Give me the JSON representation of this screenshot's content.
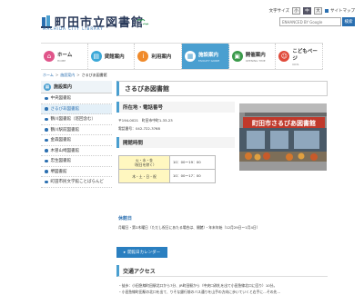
{
  "header": {
    "logo_title": "町田市立図書館",
    "logo_subtitle": "MACHIDA CITY LIBRARY",
    "font_size_label": "文字サイズ",
    "font_sizes": [
      "小",
      "中",
      "大"
    ],
    "sitemap_label": "サイトマップ",
    "search_placeholder": "ENHANCED BY Google",
    "search_button": "検索"
  },
  "nav": [
    {
      "jp": "ホーム",
      "en": "HOME",
      "icon": "home-icon",
      "color": "#e0558a"
    },
    {
      "jp": "貸館案内",
      "en": "",
      "icon": "book-icon",
      "color": "#3aa8d8"
    },
    {
      "jp": "利用案内",
      "en": "",
      "icon": "info-icon",
      "color": "#f08a2a"
    },
    {
      "jp": "施設案内",
      "en": "FACILITY GUIDE",
      "icon": "facility-icon",
      "color": "#ffffff"
    },
    {
      "jp": "開催案内",
      "en": "OPENING TIME",
      "icon": "calendar-icon",
      "color": "#3a9a4a"
    },
    {
      "jp": "こどもページ",
      "en": "KIDS",
      "icon": "kids-icon",
      "color": "#e04a3a"
    }
  ],
  "breadcrumb": {
    "home": "ホーム",
    "facility": "施設案内",
    "current": "さるびあ図書館"
  },
  "sidebar": {
    "heading": "施設案内",
    "items": [
      {
        "label": "中央図書館"
      },
      {
        "label": "さるびあ図書館"
      },
      {
        "label": "鶴川図書館（巡回含む）"
      },
      {
        "label": "鶴川駅前図書館"
      },
      {
        "label": "金森図書館"
      },
      {
        "label": "木曽山崎図書館"
      },
      {
        "label": "忠生図書館"
      },
      {
        "label": "堺図書館"
      },
      {
        "label": "町田市民文学館ことばらんど"
      }
    ],
    "active_index": 1
  },
  "main": {
    "title": "さるびあ図書館",
    "address_heading": "所在地・電話番号",
    "postal": "〒194-0021　町田市中町1-33-23",
    "phone": "電話番号：042-722-3768",
    "hours_heading": "開館時間",
    "hours": [
      {
        "day": "火・水・金\n（祝日を除く）",
        "time": "10：00～19：00"
      },
      {
        "day": "木・土・日・祝",
        "time": "10：00～17：00"
      }
    ],
    "photo_sign": "町田市さるびあ図書館",
    "closed_heading": "休館日",
    "closed_text": "月曜日・第2木曜日（ただし祝日にあたる場合は、開館）・年末年始（12月29日～1月4日）",
    "calendar_button": "開館日カレンダー",
    "traffic_heading": "交通アクセス",
    "traffic_lines": [
      "・徒歩：小田急線町田駅北口から7分、JR町田駅から（中央口改札を出て小田急線北口に回り）10分。",
      "・小田急線町田駅の北口を出て、りそな銀行前のバス通りを山手の方向に歩いていくと右手に…その先…"
    ]
  }
}
